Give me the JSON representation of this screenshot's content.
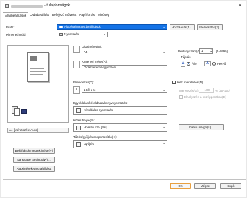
{
  "window": {
    "title": "- tulajdonságok"
  },
  "tabs": [
    {
      "label": "Alapbeállítások",
      "active": true
    },
    {
      "label": "Oldalbeállítás",
      "active": false
    },
    {
      "label": "Befejező művelet",
      "active": false
    },
    {
      "label": "Papírforrás",
      "active": false
    },
    {
      "label": "Minőség",
      "active": false
    }
  ],
  "profile": {
    "label": "Profil:",
    "value": "Alapértelmezett beállítások",
    "add_button": "Hozzáadás(1)...",
    "edit_button": "Szerkesztés(2)..."
  },
  "output_method": {
    "label": "Kimeneti mód:",
    "value": "Nyomtatás"
  },
  "page_size": {
    "label": "Oldalméret(S):",
    "value": "A4"
  },
  "output_size": {
    "label": "Kimeneti méret(A):",
    "value": "Oldalmérettel egyezzen"
  },
  "copies": {
    "label": "Példányszám(C):",
    "value": "1",
    "range": "[1–9999]"
  },
  "orientation": {
    "label": "Tájolás",
    "portrait_letter": "A",
    "portrait_label": "Álló",
    "landscape_letter": "A",
    "landscape_label": "Fekvő",
    "selected": "portrait"
  },
  "page_layout": {
    "label": "Elrendezés(Y):",
    "value": "1-től 1-re"
  },
  "manual_scaling": {
    "label": "Kézi méretezés(N)",
    "scale_label": "Méretezés(G):",
    "scale_value": "100",
    "scale_range": "% [25–200]",
    "center_label": "Elhelyezés a középpontban(E)"
  },
  "duplex": {
    "label": "Egyoldalas/kétoldalas/könyvnyomtatás:",
    "value": "Kétoldalas nyomtatás"
  },
  "binding": {
    "label": "Kötés helye(B):",
    "value": "Hosszú szél [Bal]",
    "margin_button": "Kötési margó(U)..."
  },
  "finishing": {
    "label": "Tűzés/gyűjtés/csoportosítás(H):",
    "value": "Gyűjtés"
  },
  "preview": {
    "caption": "A4 [Méretezés: Auto]"
  },
  "left_buttons": {
    "view_settings": "Beállítások megtekintése(V)",
    "language": "Language Settings(W)...",
    "restore": "Alapértékek visszaállítása"
  },
  "footer": {
    "ok": "OK",
    "cancel": "Mégse",
    "help": "Súgó"
  },
  "colors": {
    "accent": "#1473e6",
    "ok_highlight": "#e8a040"
  }
}
